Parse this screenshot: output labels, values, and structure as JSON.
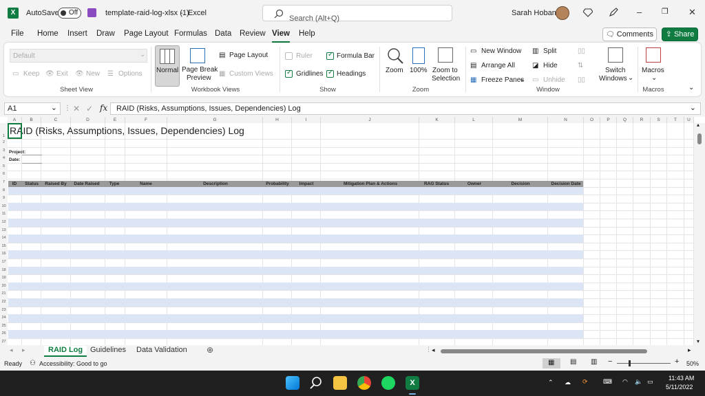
{
  "titlebar": {
    "autosave_label": "AutoSave",
    "autosave_state": "Off",
    "filename": "template-raid-log-xlsx (1)",
    "separator": "-",
    "app": "Excel",
    "search_placeholder": "Search (Alt+Q)",
    "user": "Sarah Hoban"
  },
  "tabs": [
    "File",
    "Home",
    "Insert",
    "Draw",
    "Page Layout",
    "Formulas",
    "Data",
    "Review",
    "View",
    "Help"
  ],
  "active_tab": "View",
  "buttons": {
    "comments": "Comments",
    "share": "Share"
  },
  "ribbon": {
    "sheet_view": {
      "default": "Default",
      "keep": "Keep",
      "exit": "Exit",
      "new": "New",
      "options": "Options",
      "label": "Sheet View"
    },
    "workbook_views": {
      "normal": "Normal",
      "page_break_1": "Page Break",
      "page_break_2": "Preview",
      "page_layout": "Page Layout",
      "custom_views": "Custom Views",
      "label": "Workbook Views"
    },
    "show": {
      "ruler": "Ruler",
      "formula_bar": "Formula Bar",
      "gridlines": "Gridlines",
      "headings": "Headings",
      "label": "Show"
    },
    "zoom": {
      "zoom": "Zoom",
      "hundred": "100%",
      "zoom_to_1": "Zoom to",
      "zoom_to_2": "Selection",
      "label": "Zoom"
    },
    "window": {
      "new_window": "New Window",
      "arrange_all": "Arrange All",
      "freeze_panes": "Freeze Panes",
      "split": "Split",
      "hide": "Hide",
      "unhide": "Unhide",
      "switch_1": "Switch",
      "switch_2": "Windows",
      "label": "Window"
    },
    "macros": {
      "macros": "Macros",
      "label": "Macros"
    }
  },
  "formula_bar": {
    "cell": "A1",
    "content": "RAID (Risks, Assumptions, Issues, Dependencies) Log"
  },
  "sheet": {
    "columns": [
      "A",
      "B",
      "C",
      "D",
      "E",
      "F",
      "G",
      "H",
      "I",
      "J",
      "K",
      "L",
      "M",
      "N",
      "O",
      "P",
      "Q",
      "R",
      "S",
      "T",
      "U"
    ],
    "title": "RAID (Risks, Assumptions, Issues, Dependencies) Log",
    "project_label": "Project:",
    "date_label": "Date:",
    "table_headers": [
      "ID",
      "Status",
      "Raised By",
      "Date Raised",
      "Type",
      "Name",
      "Description",
      "Probability",
      "Impact",
      "Mitigation Plan & Actions",
      "RAG Status",
      "Owner",
      "Decision",
      "Decision Date"
    ]
  },
  "sheet_tabs": [
    "RAID Log",
    "Guidelines",
    "Data Validation"
  ],
  "status": {
    "ready": "Ready",
    "accessibility": "Accessibility: Good to go",
    "zoom": "50%"
  },
  "taskbar": {
    "time": "11:43 AM",
    "date": "5/11/2022"
  }
}
